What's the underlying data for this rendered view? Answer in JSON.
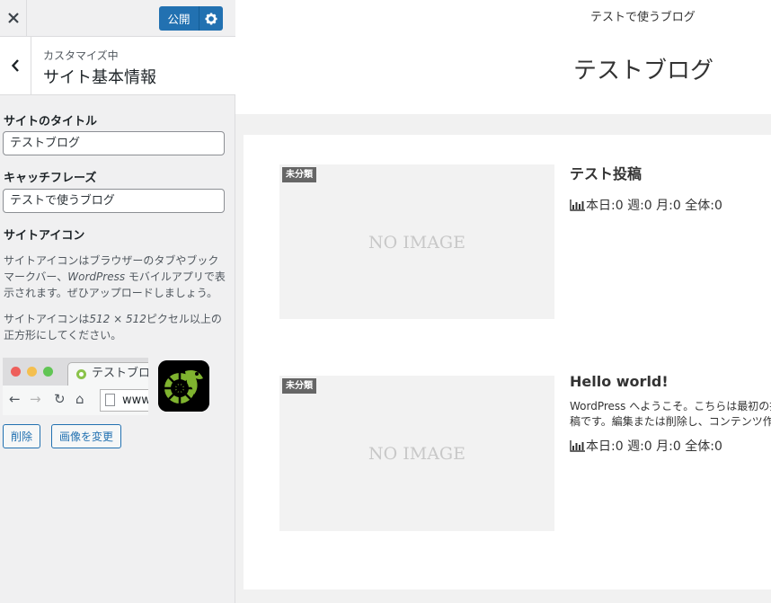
{
  "topbar": {
    "close_icon": "close-icon",
    "publish_label": "公開",
    "settings_icon": "gear-icon"
  },
  "section": {
    "subtitle": "カスタマイズ中",
    "title": "サイト基本情報",
    "back_icon": "chevron-left-icon"
  },
  "controls": {
    "site_title_label": "サイトのタイトル",
    "site_title_value": "テストブログ",
    "tagline_label": "キャッチフレーズ",
    "tagline_value": "テストで使うブログ",
    "site_icon_label": "サイトアイコン",
    "site_icon_desc_1a": "サイトアイコンはブラウザーのタブやブックマークバー、",
    "site_icon_desc_1b": "WordPress",
    "site_icon_desc_1c": " モバイルアプリで表示されます。ぜひアップロードしましょう。",
    "site_icon_desc_2a": "サイトアイコンは",
    "site_icon_desc_2b": "512 × 512",
    "site_icon_desc_2c": "ピクセル以上の正方形にしてください。",
    "browser_tab_text": "テストブログ",
    "browser_url_text": "www.",
    "remove_label": "削除",
    "change_image_label": "画像を変更"
  },
  "preview": {
    "site_description": "テストで使うブログ",
    "site_title": "テストブログ",
    "posts": [
      {
        "category": "未分類",
        "thumb_text": "NO IMAGE",
        "title": "テスト投稿",
        "excerpt": "",
        "stats": "本日:0 週:0 月:0 全体:0"
      },
      {
        "category": "未分類",
        "thumb_text": "NO IMAGE",
        "title": "Hello world!",
        "excerpt": "WordPress へようこそ。こちらは最初の投稿です。編集または削除し、コンテンツ作成を始めてください。",
        "stats": "本日:0 週:0 月:0 全体:0"
      }
    ]
  },
  "colors": {
    "primary_button": "#2271b1",
    "sidebar_bg": "#f0f0f1",
    "badge_bg": "#666666",
    "thumb_bg": "#f2f2f2"
  }
}
